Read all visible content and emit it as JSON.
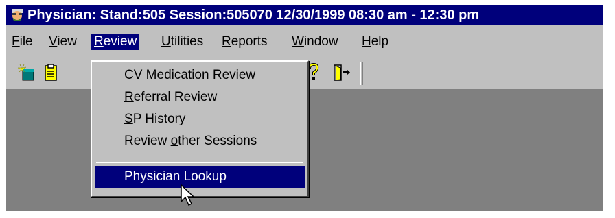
{
  "window": {
    "title": "Physician: Stand:505 Session:505070 12/30/1999 08:30 am - 12:30 pm",
    "icon": "physician-face-icon"
  },
  "menubar": {
    "items": [
      {
        "key": "F",
        "rest": "ile"
      },
      {
        "key": "V",
        "rest": "iew"
      },
      {
        "key": "R",
        "rest": "eview"
      },
      {
        "key": "U",
        "rest": "tilities"
      },
      {
        "key": "R",
        "rest": "eports"
      },
      {
        "key": "W",
        "rest": "indow"
      },
      {
        "key": "H",
        "rest": "elp"
      }
    ],
    "open_menu": "Review"
  },
  "toolbar": {
    "icons": [
      "new-sparkle-icon",
      "clipboard-icon",
      "help-question-icon",
      "exit-door-icon"
    ]
  },
  "review_menu": {
    "items": [
      {
        "pre": "",
        "key": "C",
        "rest": "V Medication Review"
      },
      {
        "pre": "",
        "key": "R",
        "rest": "eferral Review"
      },
      {
        "pre": "",
        "key": "S",
        "rest": "P History"
      },
      {
        "pre": "Review ",
        "key": "o",
        "rest": "ther Sessions"
      },
      {
        "pre": "",
        "key": "",
        "rest": "Physician Lookup"
      }
    ],
    "highlighted": "Physician Lookup"
  },
  "colors": {
    "titlebar": "#00007b",
    "face": "#c0c0c0",
    "client": "#808080",
    "highlight": "#00007b"
  }
}
